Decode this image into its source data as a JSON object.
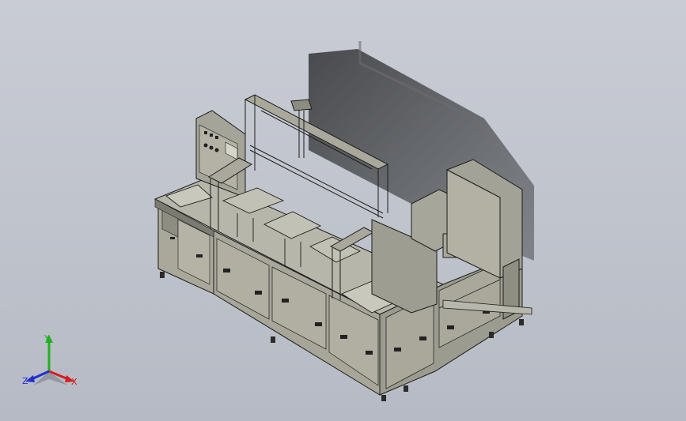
{
  "view": {
    "background_color": "#c3c7cf",
    "model_fill": "#a8a79a",
    "model_dark": "#6f6e64",
    "model_edge": "#1c1c1a",
    "shadow_color": "#2f3132"
  },
  "triad": {
    "x_label": "X",
    "y_label": "Y",
    "z_label": "Z",
    "x_color": "#d21f1f",
    "y_color": "#1fb21f",
    "z_color": "#1f2fd2"
  }
}
